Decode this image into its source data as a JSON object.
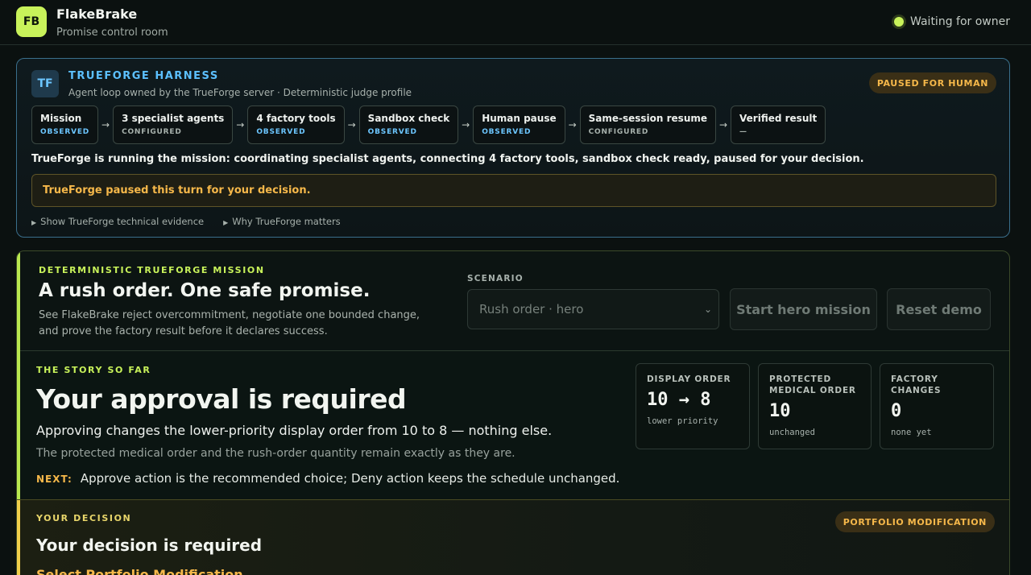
{
  "app": {
    "logo": "FB",
    "title": "FlakeBrake",
    "subtitle": "Promise control room",
    "status": "Waiting for owner"
  },
  "harness": {
    "badge": "TF",
    "title": "TRUEFORGE HARNESS",
    "subtitle": "Agent loop owned by the TrueForge server · Deterministic judge profile",
    "state_pill": "PAUSED FOR HUMAN",
    "steps": [
      {
        "name": "Mission",
        "state": "OBSERVED"
      },
      {
        "name": "3 specialist agents",
        "state": "CONFIGURED"
      },
      {
        "name": "4 factory tools",
        "state": "OBSERVED"
      },
      {
        "name": "Sandbox check",
        "state": "OBSERVED"
      },
      {
        "name": "Human pause",
        "state": "OBSERVED"
      },
      {
        "name": "Same-session resume",
        "state": "CONFIGURED"
      },
      {
        "name": "Verified result",
        "state": "—"
      }
    ],
    "arrow": "→",
    "message": "TrueForge is running the mission: coordinating specialist agents, connecting 4 factory tools, sandbox check ready, paused for your decision.",
    "paused_note": "TrueForge paused this turn for your decision.",
    "links": [
      "Show TrueForge technical evidence",
      "Why TrueForge matters"
    ]
  },
  "mission": {
    "kicker": "DETERMINISTIC TRUEFORGE MISSION",
    "title": "A rush order. One safe promise.",
    "description": "See FlakeBrake reject overcommitment, negotiate one bounded change, and prove the factory result before it declares success.",
    "scenario_label": "SCENARIO",
    "scenario_value": "Rush order · hero",
    "start_button": "Start hero mission",
    "reset_button": "Reset demo"
  },
  "story": {
    "kicker": "THE STORY SO FAR",
    "title": "Your approval is required",
    "line1": "Approving changes the lower-priority display order from 10 to 8 — nothing else.",
    "line2": "The protected medical order and the rush-order quantity remain exactly as they are.",
    "next_label": "NEXT:",
    "next_text": "Approve action is the recommended choice; Deny action keeps the schedule unchanged.",
    "metrics": [
      {
        "label": "DISPLAY ORDER",
        "value": "10 → 8",
        "note": "lower priority"
      },
      {
        "label": "PROTECTED MEDICAL ORDER",
        "value": "10",
        "note": "unchanged"
      },
      {
        "label": "FACTORY CHANGES",
        "value": "0",
        "note": "none yet"
      }
    ]
  },
  "decision": {
    "kicker": "YOUR DECISION",
    "title": "Your decision is required",
    "pill": "PORTFOLIO MODIFICATION",
    "select_link": "Select Portfolio Modification"
  }
}
